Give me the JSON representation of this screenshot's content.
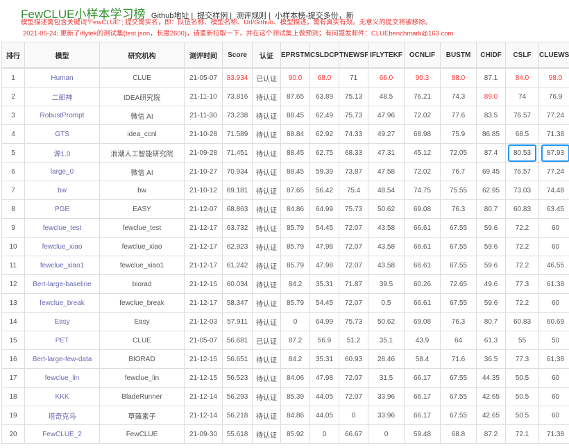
{
  "header": {
    "title": "FewCLUE小样本学习榜",
    "links": [
      "Github地址",
      "提交样例",
      "测评规则",
      "小样本榜-提交多份，新"
    ],
    "notice1": "模型描述需包含关键词\"FewCLUE\"; 提交需实名，即：队伍名称、模型名称、Url/Github、模型描述，需有真实有效。无意义的提交将被移除。",
    "notice2": "2021-05-24: 更新了iflytek的测试集(test.json，长度2600)，请重新拉取一下，并在这个测试集上做预测；有问题发邮件：CLUEbenchmark@163.com"
  },
  "colors": {
    "title": "#2f8f2f",
    "notice": "#ee3333",
    "highlight": "#f33333",
    "model_link": "#6a6ab0",
    "box": "#2196f3"
  },
  "table": {
    "columns": [
      "排行",
      "模型",
      "研究机构",
      "测评时间",
      "Score",
      "认证",
      "EPRSTMT",
      "CSLDCP",
      "TNEWSF",
      "IFLYTEKF",
      "OCNLIF",
      "BUSTM",
      "CHIDF",
      "CSLF",
      "CLUEWSC"
    ],
    "rows": [
      {
        "cells": [
          "1",
          "Human",
          "CLUE",
          "21-05-07",
          "83.934",
          "已认证",
          "90.0",
          "68.0",
          "71",
          "66.0",
          "90.3",
          "88.0",
          "87.1",
          "84.0",
          "98.0"
        ],
        "red": [
          4,
          6,
          7,
          9,
          10,
          11,
          13,
          14
        ]
      },
      {
        "cells": [
          "2",
          "二郎神",
          "IDEA研究院",
          "21-11-10",
          "73.816",
          "待认证",
          "87.65",
          "63.89",
          "75.13",
          "48.5",
          "76.21",
          "74.3",
          "89.0",
          "74",
          "76.9"
        ],
        "red": [
          12
        ]
      },
      {
        "cells": [
          "3",
          "RobustPrompt",
          "微信 AI",
          "21-11-30",
          "73.238",
          "待认证",
          "88.45",
          "62.49",
          "75.73",
          "47.96",
          "72.02",
          "77.6",
          "83.5",
          "76.57",
          "77.24"
        ]
      },
      {
        "cells": [
          "4",
          "GTS",
          "idea_ccnl",
          "21-10-28",
          "71.589",
          "待认证",
          "88.84",
          "62.92",
          "74.33",
          "49.27",
          "68.98",
          "75.9",
          "86.85",
          "68.5",
          "71.38"
        ]
      },
      {
        "cells": [
          "5",
          "源1.0",
          "浪潮人工智能研究院",
          "21-09-28",
          "71.451",
          "待认证",
          "88.45",
          "62.75",
          "68.33",
          "47.31",
          "45.12",
          "72.05",
          "87.4",
          "80.53",
          "87.93"
        ],
        "boxed": [
          13,
          14
        ]
      },
      {
        "cells": [
          "6",
          "large_0",
          "微信 AI",
          "21-10-27",
          "70.934",
          "待认证",
          "88.45",
          "59.39",
          "73.87",
          "47.58",
          "72.02",
          "76.7",
          "69.45",
          "76.57",
          "77.24"
        ]
      },
      {
        "cells": [
          "7",
          "bw",
          "bw",
          "21-10-12",
          "69.181",
          "待认证",
          "87.65",
          "56.42",
          "75.4",
          "48.54",
          "74.75",
          "75.55",
          "62.95",
          "73.03",
          "74.48"
        ]
      },
      {
        "cells": [
          "8",
          "PGE",
          "EASY",
          "21-12-07",
          "68.863",
          "待认证",
          "84.86",
          "64.99",
          "75.73",
          "50.62",
          "69.08",
          "76.3",
          "80.7",
          "60.83",
          "63.45"
        ]
      },
      {
        "cells": [
          "9",
          "fewclue_test",
          "fewclue_test",
          "21-12-17",
          "63.732",
          "待认证",
          "85.79",
          "54.45",
          "72.07",
          "43.58",
          "66.61",
          "67.55",
          "59.6",
          "72.2",
          "60"
        ]
      },
      {
        "cells": [
          "10",
          "fewclue_xiao",
          "fewclue_xiao",
          "21-12-17",
          "62.923",
          "待认证",
          "85.79",
          "47.98",
          "72.07",
          "43.58",
          "66.61",
          "67.55",
          "59.6",
          "72.2",
          "60"
        ]
      },
      {
        "cells": [
          "11",
          "fewclue_xiao1",
          "fewclue_xiao1",
          "21-12-17",
          "61.242",
          "待认证",
          "85.79",
          "47.98",
          "72.07",
          "43.58",
          "66.61",
          "67.55",
          "59.6",
          "72.2",
          "46.55"
        ]
      },
      {
        "cells": [
          "12",
          "Bert-large-baseline",
          "biorad",
          "21-12-15",
          "60.034",
          "待认证",
          "84.2",
          "35.31",
          "71.87",
          "39.5",
          "60.26",
          "72.65",
          "49.6",
          "77.3",
          "61.38"
        ]
      },
      {
        "cells": [
          "13",
          "fewclue_break",
          "fewclue_break",
          "21-12-17",
          "58.347",
          "待认证",
          "85.79",
          "54.45",
          "72.07",
          "0.5",
          "66.61",
          "67.55",
          "59.6",
          "72.2",
          "60"
        ]
      },
      {
        "cells": [
          "14",
          "Easy",
          "Easy",
          "21-12-03",
          "57.911",
          "待认证",
          "0",
          "64.99",
          "75.73",
          "50.62",
          "69.08",
          "76.3",
          "80.7",
          "60.83",
          "60.69"
        ]
      },
      {
        "cells": [
          "15",
          "PET",
          "CLUE",
          "21-05-07",
          "56.681",
          "已认证",
          "87.2",
          "56.9",
          "51.2",
          "35.1",
          "43.9",
          "64",
          "61.3",
          "55",
          "50"
        ]
      },
      {
        "cells": [
          "16",
          "Bert-large-few-data",
          "BIORAD",
          "21-12-15",
          "56.651",
          "待认证",
          "84.2",
          "35.31",
          "60.93",
          "28.46",
          "58.4",
          "71.6",
          "36.5",
          "77.3",
          "61.38"
        ]
      },
      {
        "cells": [
          "17",
          "fewclue_lin",
          "fewclue_lin",
          "21-12-15",
          "56.523",
          "待认证",
          "84.06",
          "47.98",
          "72.07",
          "31.5",
          "66.17",
          "67.55",
          "44.35",
          "50.5",
          "60"
        ]
      },
      {
        "cells": [
          "18",
          "KKK",
          "BladeRunner",
          "21-12-14",
          "56.293",
          "待认证",
          "85.39",
          "44.05",
          "72.07",
          "33.96",
          "66.17",
          "67.55",
          "42.65",
          "50.5",
          "60"
        ]
      },
      {
        "cells": [
          "19",
          "塔奇克马",
          "草薙素子",
          "21-12-14",
          "56.218",
          "待认证",
          "84.86",
          "44.05",
          "0",
          "33.96",
          "66.17",
          "67.55",
          "42.65",
          "50.5",
          "60"
        ]
      },
      {
        "cells": [
          "20",
          "FewCLUE_2",
          "FewCLUE",
          "21-09-30",
          "55.618",
          "待认证",
          "85.92",
          "0",
          "66.67",
          "0",
          "59.48",
          "68.8",
          "87.2",
          "72.1",
          "71.38"
        ]
      }
    ]
  }
}
